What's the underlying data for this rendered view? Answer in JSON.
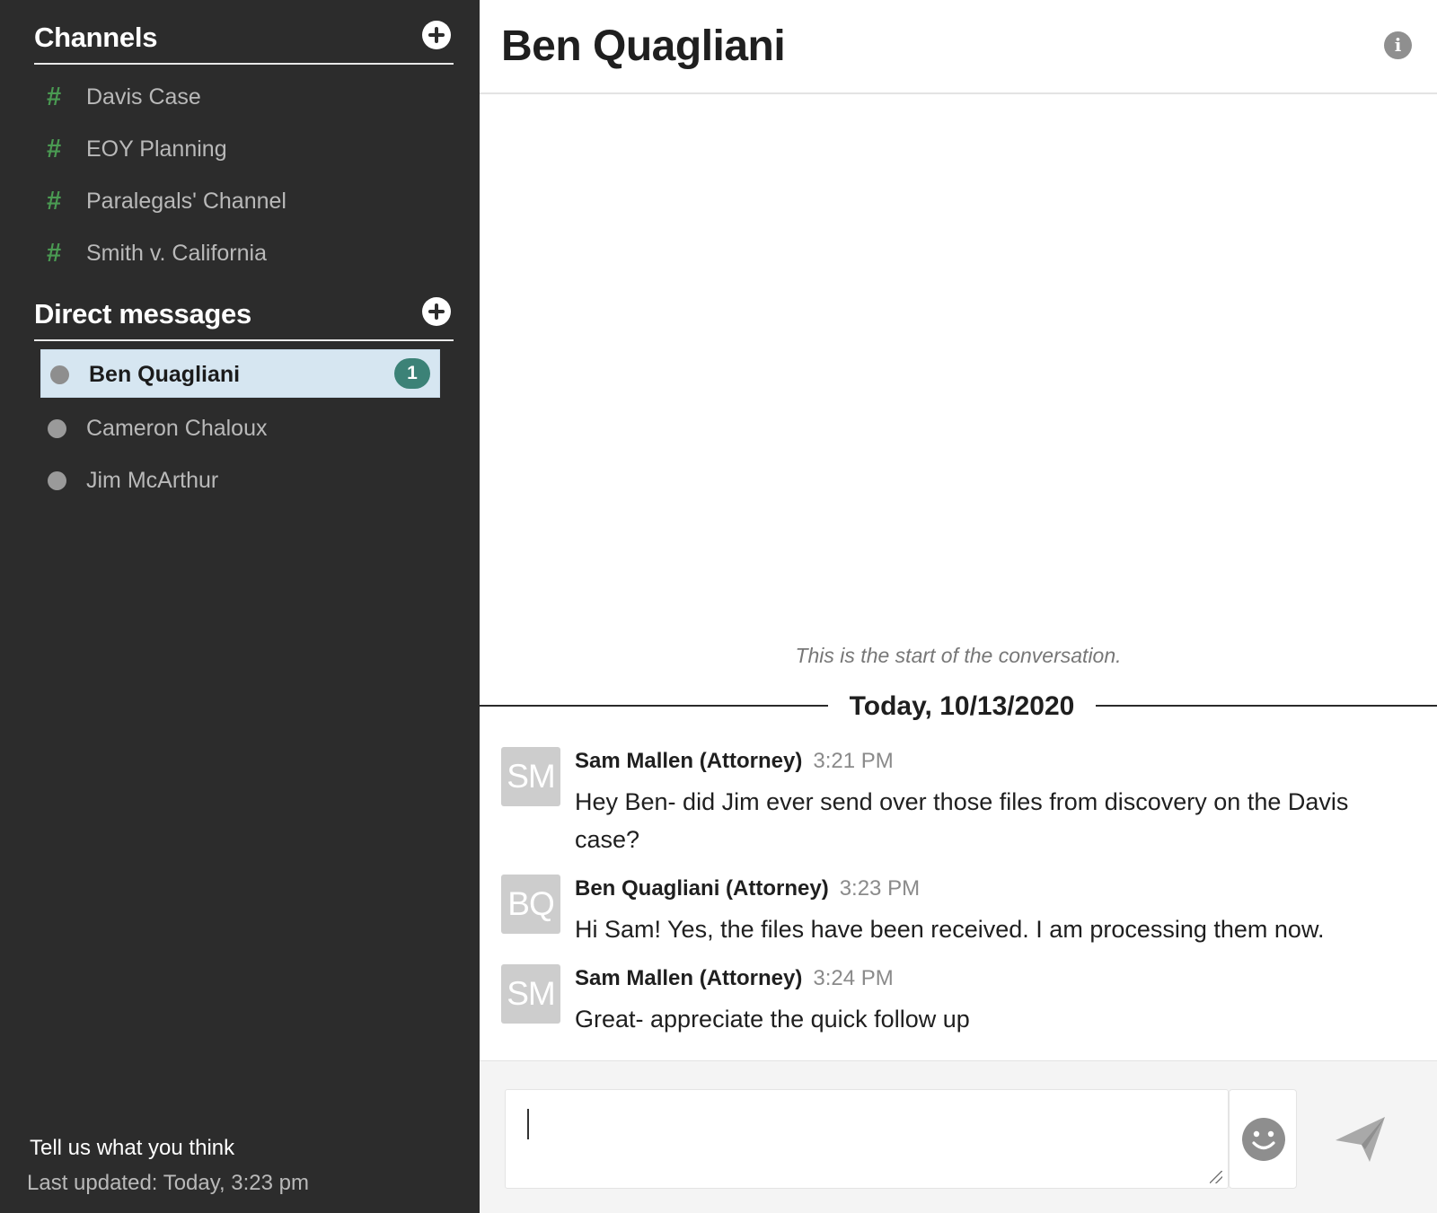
{
  "sidebar": {
    "channels_title": "Channels",
    "channels": [
      {
        "label": "Davis Case",
        "icon": "#"
      },
      {
        "label": "EOY Planning",
        "icon": "#"
      },
      {
        "label": "Paralegals' Channel",
        "icon": "#"
      },
      {
        "label": "Smith v. California",
        "icon": "#"
      }
    ],
    "dm_title": "Direct messages",
    "direct_messages": [
      {
        "label": "Ben Quagliani",
        "active": true,
        "unread": "1"
      },
      {
        "label": "Cameron Chaloux",
        "active": false
      },
      {
        "label": "Jim McArthur",
        "active": false
      }
    ],
    "feedback": "Tell us what you think",
    "last_updated": "Last updated: Today, 3:23 pm"
  },
  "chat": {
    "title": "Ben Quagliani",
    "info_icon": "i",
    "start_notice": "This is the start of the conversation.",
    "date_label": "Today, 10/13/2020",
    "messages": [
      {
        "initials": "SM",
        "author": "Sam Mallen (Attorney)",
        "time": "3:21 PM",
        "text": "Hey Ben- did Jim ever send over those files from discovery on the Davis case?"
      },
      {
        "initials": "BQ",
        "author": "Ben Quagliani (Attorney)",
        "time": "3:23 PM",
        "text": "Hi Sam! Yes, the files have been received. I am processing them now."
      },
      {
        "initials": "SM",
        "author": "Sam Mallen (Attorney)",
        "time": "3:24 PM",
        "text": "Great- appreciate the quick follow up"
      }
    ]
  },
  "composer": {
    "value": "",
    "emoji_icon": "smiley-face-icon",
    "send_icon": "paper-plane-icon"
  },
  "colors": {
    "sidebar_bg": "#2c2c2c",
    "channel_hash": "#4a9a52",
    "active_dm_bg": "#d6e6f1",
    "unread_badge": "#3c8277",
    "avatar_bg": "#cdcdcd"
  }
}
